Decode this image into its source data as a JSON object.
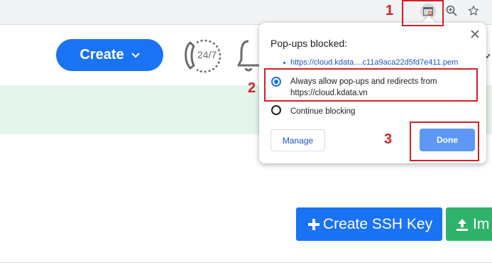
{
  "browser": {
    "icons": [
      "popup-blocked-icon",
      "zoom-icon",
      "star-icon"
    ]
  },
  "header": {
    "create_label": "Create",
    "support_text": "24/7"
  },
  "popup": {
    "title": "Pop-ups blocked:",
    "blocked_link": "https://cloud.kdata....c11a9aca22d5fd7e411.pem",
    "option_allow": "Always allow pop-ups and redirects from https://cloud.kdata.vn",
    "option_block": "Continue blocking",
    "selected_option": "allow",
    "manage_label": "Manage",
    "done_label": "Done"
  },
  "actions": {
    "ssh_label": "Create SSH Key",
    "import_label": "Im"
  },
  "annotations": [
    "1",
    "2",
    "3"
  ],
  "colors": {
    "primary_blue": "#1a73f5",
    "annotation_red": "#d32027",
    "banner_green": "#e3f4ea",
    "done_blue": "#5e97f6",
    "import_green": "#2fb36b"
  }
}
